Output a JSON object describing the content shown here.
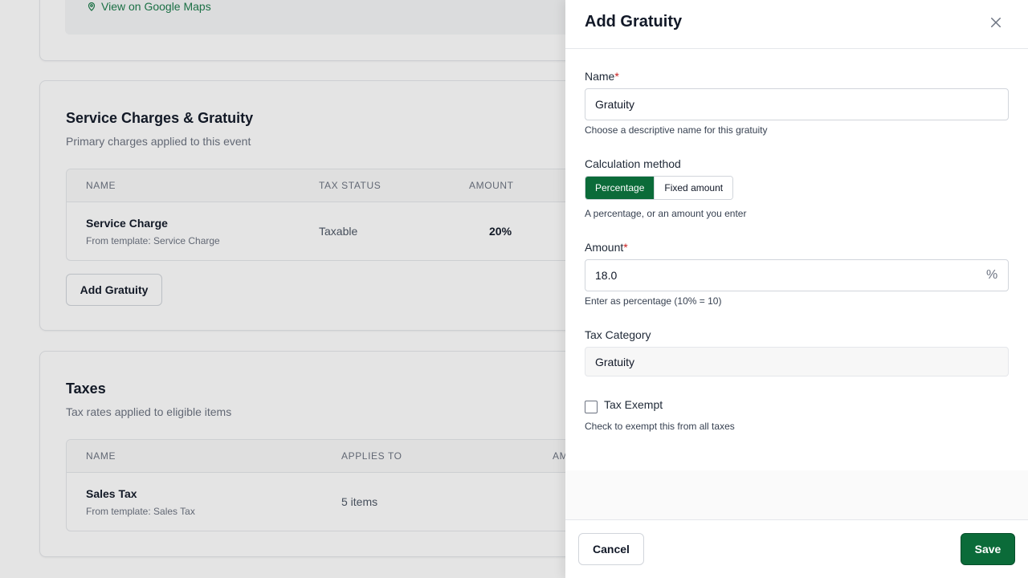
{
  "background": {
    "maps_link": "View on Google Maps",
    "service": {
      "title": "Service Charges & Gratuity",
      "subtitle": "Primary charges applied to this event",
      "columns": [
        "NAME",
        "TAX STATUS",
        "AMOUNT"
      ],
      "rows": [
        {
          "name": "Service Charge",
          "sub": "From template: Service Charge",
          "tax_status": "Taxable",
          "amount": "20%"
        }
      ],
      "add_button": "Add Gratuity"
    },
    "taxes": {
      "title": "Taxes",
      "subtitle": "Tax rates applied to eligible items",
      "columns": [
        "NAME",
        "APPLIES TO",
        "AM"
      ],
      "rows": [
        {
          "name": "Sales Tax",
          "sub": "From template: Sales Tax",
          "applies_to": "5 items"
        }
      ]
    }
  },
  "drawer": {
    "title": "Add Gratuity",
    "name": {
      "label": "Name",
      "required_mark": "*",
      "value": "Gratuity",
      "help": "Choose a descriptive name for this gratuity"
    },
    "method": {
      "label": "Calculation method",
      "options": [
        "Percentage",
        "Fixed amount"
      ],
      "selected": "Percentage",
      "help": "A percentage, or an amount you enter"
    },
    "amount": {
      "label": "Amount",
      "required_mark": "*",
      "value": "18.0",
      "suffix": "%",
      "help": "Enter as percentage (10% = 10)"
    },
    "tax_category": {
      "label": "Tax Category",
      "value": "Gratuity"
    },
    "tax_exempt": {
      "label": "Tax Exempt",
      "checked": false,
      "help": "Check to exempt this from all taxes"
    },
    "footer": {
      "cancel": "Cancel",
      "save": "Save"
    }
  },
  "colors": {
    "brand_green": "#0b6b39",
    "required_red": "#c81e1e"
  }
}
